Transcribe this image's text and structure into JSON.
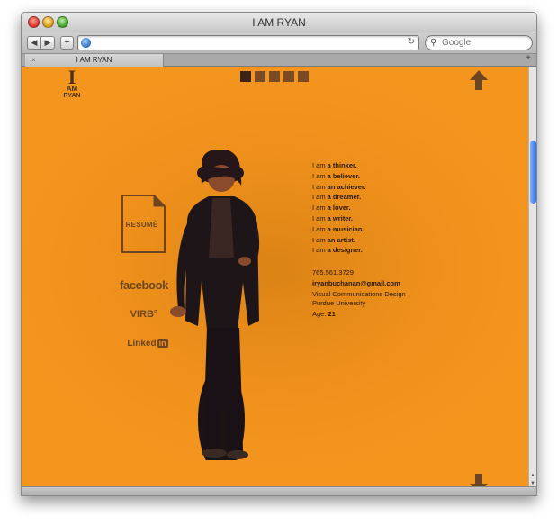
{
  "window": {
    "title": "I AM RYAN"
  },
  "toolbar": {
    "back_glyph": "◀",
    "forward_glyph": "▶",
    "add_glyph": "+",
    "url_value": "",
    "reload_glyph": "↻",
    "search_placeholder": "Google",
    "search_glyph": "⚲"
  },
  "tabs": [
    {
      "label": "I AM RYAN"
    }
  ],
  "tabbar": {
    "close_glyph": "×",
    "new_tab_glyph": "+"
  },
  "colors": {
    "background": "#ee901b",
    "text_dark": "#2a1810",
    "brown": "#6e4522",
    "pager_active": "#3a2418",
    "pager_inactive": "#7a4a24"
  },
  "site": {
    "logo": {
      "line1": "I",
      "line2": "AM",
      "line3": "RYAN"
    },
    "pager": {
      "count": 5,
      "active_index": 0
    },
    "resume_label": "RESUMÈ",
    "social": {
      "facebook": "facebook",
      "virb": "VIRB°",
      "linkedin_text": "Linked",
      "linkedin_box": "in"
    },
    "bio": [
      {
        "prefix": "I am ",
        "emph": "a thinker."
      },
      {
        "prefix": "I am ",
        "emph": "a believer."
      },
      {
        "prefix": "I am ",
        "emph": "an achiever."
      },
      {
        "prefix": "I am ",
        "emph": "a dreamer."
      },
      {
        "prefix": "I am ",
        "emph": "a lover."
      },
      {
        "prefix": "I am ",
        "emph": "a writer."
      },
      {
        "prefix": "I am ",
        "emph": "a musician."
      },
      {
        "prefix": "I am ",
        "emph": "an artist."
      },
      {
        "prefix": "I am ",
        "emph": "a designer."
      }
    ],
    "contact": {
      "phone": "765.561.3729",
      "email": "iryanbuchanan@gmail.com",
      "program": "Visual Communications Design",
      "school": "Purdue University",
      "age_label": "Age: ",
      "age_value": "21"
    }
  }
}
